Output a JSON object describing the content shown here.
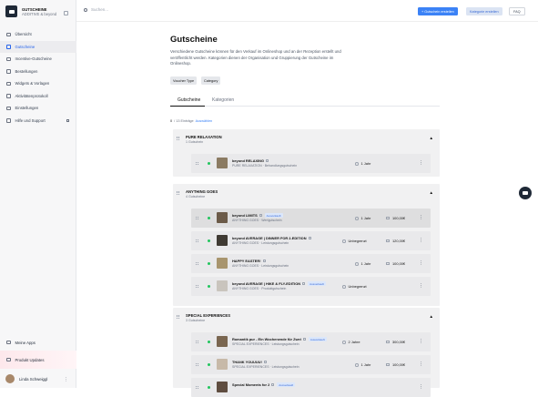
{
  "app": {
    "title": "GUTSCHEINE",
    "subtitle": "ADDITIVE & beyond"
  },
  "sidebar": {
    "items": [
      {
        "label": "Übersicht",
        "active": false
      },
      {
        "label": "Gutscheine",
        "active": true
      },
      {
        "label": "Incentive-Gutscheine",
        "active": false
      },
      {
        "label": "Bestellungen",
        "active": false
      },
      {
        "label": "Widgets & Vorlagen",
        "active": false
      },
      {
        "label": "Aktivitätenprotokoll",
        "active": false
      },
      {
        "label": "Einstellungen",
        "active": false
      },
      {
        "label": "Hilfe und Support",
        "active": false
      }
    ],
    "bottom": {
      "apps": "Meine Apps",
      "updates": "Produkt Updates",
      "user": "Linda Schweiggl"
    }
  },
  "topbar": {
    "search_placeholder": "Suchen...",
    "create_voucher": "+ Gutschein erstellen",
    "create_category": "Kategorie erstellen",
    "faq": "FAQ"
  },
  "page": {
    "title": "Gutscheine",
    "description": "Verschiedene Gutscheine können für den Verkauf im Onlineshop und an der Rezeption erstellt und veröffentlicht werden. Kategorien dienen der Organisation und Gruppierung der Gutscheine im Onlineshop.",
    "filters": [
      "Voucher Type",
      "Category"
    ],
    "tabs": [
      "Gutscheine",
      "Kategorien"
    ],
    "selection": {
      "count": "0",
      "of": "/ 13 Einträge",
      "link": "Auswählen"
    }
  },
  "groups": [
    {
      "title": "PURE RELAXATION",
      "sub": "1 Gutschein",
      "items": [
        {
          "name": "beyond RELAXING",
          "sub": "PURE RELAXATION · Behandlungsgutschein",
          "badge": "",
          "duration": "1 Jahr",
          "price": ""
        }
      ]
    },
    {
      "title": "ANYTHING GOES",
      "sub": "4 Gutscheine",
      "items": [
        {
          "name": "beyond LIMITS",
          "sub": "ANYTHING GOES · Wertgutschein",
          "badge": "Ausverkauft",
          "duration": "1 Jahr",
          "price": "100,00€"
        },
        {
          "name": "beyond AVERAGE | DINNER FOR 2-EDITION",
          "sub": "ANYTHING GOES · Leistungsgutschein",
          "badge": "",
          "duration": "Unbegrenzt",
          "price": "120,00€"
        },
        {
          "name": "HAPPY EASTER!",
          "sub": "ANYTHING GOES · Leistungsgutschein",
          "badge": "",
          "duration": "1 Jahr",
          "price": "100,00€"
        },
        {
          "name": "beyond AVERAGE | HIKE & FLY-EDITION",
          "sub": "ANYTHING GOES · Produktgutschein",
          "badge": "Ausverkauft",
          "duration": "Unbegrenzt",
          "price": ""
        }
      ]
    },
    {
      "title": "SPECIAL EXPERIENCES",
      "sub": "3 Gutscheine",
      "items": [
        {
          "name": "Romantik pur - Ein Wochenende für Zwei",
          "sub": "SPECIAL EXPERIENCES · Leistungsgutschein",
          "badge": "Ausverkauft",
          "duration": "2 Jahre",
          "price": "300,00€"
        },
        {
          "name": "THANK YOUUUU!",
          "sub": "SPECIAL EXPERIENCES · Leistungsgutschein",
          "badge": "",
          "duration": "1 Jahr",
          "price": "100,00€"
        },
        {
          "name": "Special Moments for 2",
          "sub": "",
          "badge": "Ausverkauft",
          "duration": "",
          "price": ""
        }
      ]
    }
  ],
  "colors": {
    "accent": "#3b82f6",
    "active_dot": "#22c55e"
  }
}
